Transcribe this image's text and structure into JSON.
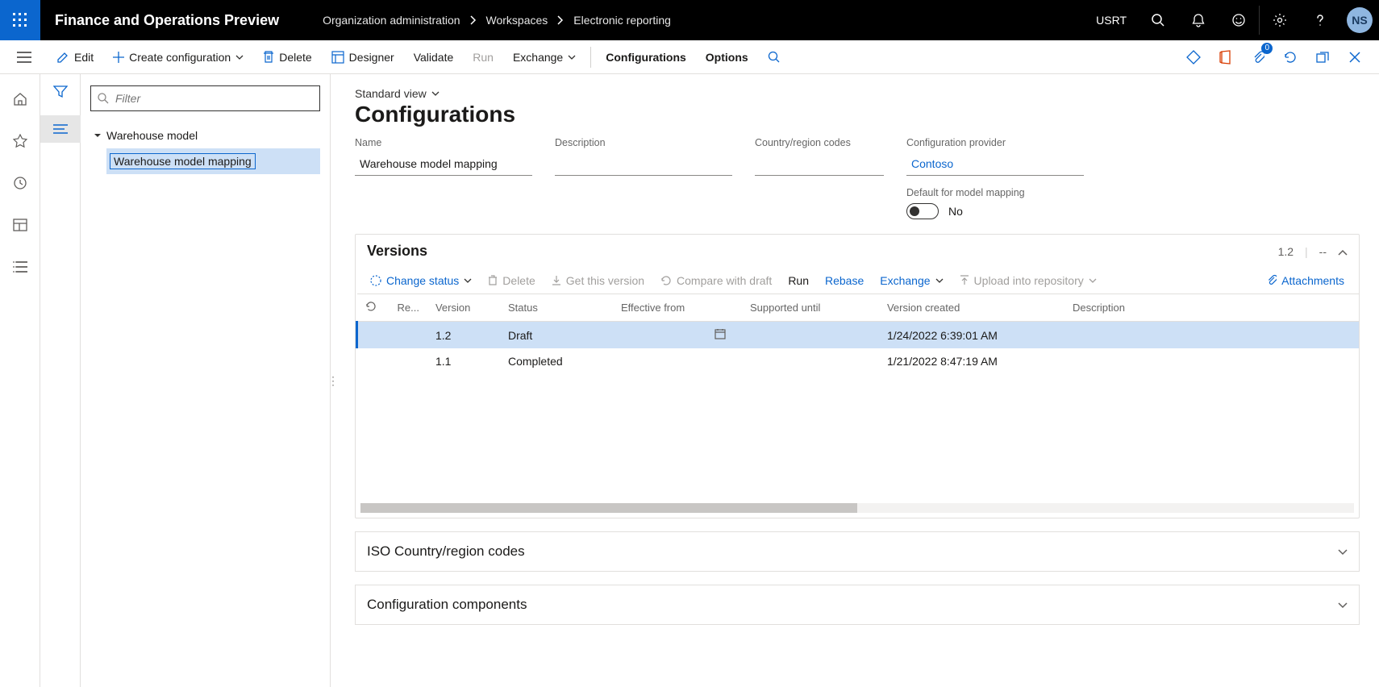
{
  "header": {
    "product": "Finance and Operations Preview",
    "breadcrumbs": [
      "Organization administration",
      "Workspaces",
      "Electronic reporting"
    ],
    "company": "USRT",
    "avatar_initials": "NS"
  },
  "actionbar": {
    "edit": "Edit",
    "create": "Create configuration",
    "delete": "Delete",
    "designer": "Designer",
    "validate": "Validate",
    "run": "Run",
    "exchange": "Exchange",
    "configurations": "Configurations",
    "options": "Options",
    "attach_count": "0"
  },
  "tree": {
    "filter_placeholder": "Filter",
    "root": "Warehouse model",
    "child": "Warehouse model mapping"
  },
  "main": {
    "view_label": "Standard view",
    "page_title": "Configurations",
    "name_label": "Name",
    "name_value": "Warehouse model mapping",
    "description_label": "Description",
    "description_value": "",
    "country_label": "Country/region codes",
    "country_value": "",
    "provider_label": "Configuration provider",
    "provider_value": "Contoso",
    "default_mapping_label": "Default for model mapping",
    "default_mapping_value": "No"
  },
  "versions": {
    "title": "Versions",
    "header_version": "1.2",
    "header_dashes": "--",
    "toolbar": {
      "change_status": "Change status",
      "delete": "Delete",
      "get": "Get this version",
      "compare": "Compare with draft",
      "run": "Run",
      "rebase": "Rebase",
      "exchange": "Exchange",
      "upload": "Upload into repository",
      "attachments": "Attachments"
    },
    "columns": {
      "re": "Re...",
      "version": "Version",
      "status": "Status",
      "effective": "Effective from",
      "supported": "Supported until",
      "created": "Version created",
      "description": "Description"
    },
    "rows": [
      {
        "version": "1.2",
        "status": "Draft",
        "effective": "",
        "supported": "",
        "created": "1/24/2022 6:39:01 AM",
        "description": ""
      },
      {
        "version": "1.1",
        "status": "Completed",
        "effective": "",
        "supported": "",
        "created": "1/21/2022 8:47:19 AM",
        "description": ""
      }
    ]
  },
  "bottom_cards": {
    "iso": "ISO Country/region codes",
    "components": "Configuration components"
  }
}
